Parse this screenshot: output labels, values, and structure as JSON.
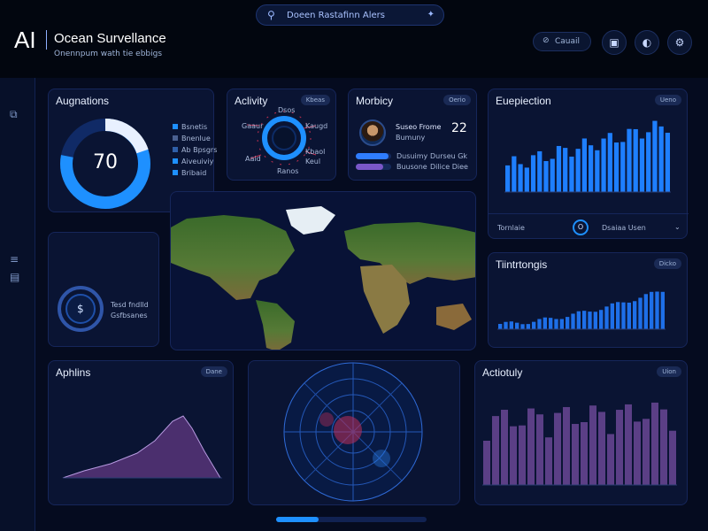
{
  "header": {
    "logo": "AI",
    "title": "Ocean Survellance",
    "subtitle": "Onennpum wath tie ebbigs",
    "search_text": "Doeen Rastafinn Alers",
    "pill_label": "Cauail"
  },
  "panels": {
    "augmentations": {
      "title": "Augnations",
      "value": "70",
      "gauge_fraction": 0.78,
      "legend": [
        "Bsnetis",
        "Bnenlue",
        "Ab Bpsgrs",
        "Aiveuiviy",
        "Bribaid"
      ],
      "legend_colors": [
        "#1e90ff",
        "#4a6090",
        "#2f5fa8",
        "#1e90ff",
        "#1e90ff"
      ]
    },
    "activity_ring": {
      "title": "Aclivity",
      "tag": "Kbeas",
      "labels": [
        "Dsos",
        "Gaaur",
        "Kaugd",
        "Aaid",
        "Kbaol",
        "Keul",
        "Ranos"
      ]
    },
    "monitoring": {
      "title": "Morbicy",
      "tag": "Oerio",
      "person_name": "Suseo Frome",
      "person_role": "Bumuny",
      "count": "22",
      "rows": [
        {
          "left": "Dusuimy",
          "right": "Durseu Gk",
          "fill": 0.92
        },
        {
          "left": "Buusone",
          "right": "Dilice Diee",
          "fill": 0.78
        }
      ]
    },
    "prediction": {
      "title": "Euepiection",
      "tag": "Ueno",
      "footer_left": "Tornlaie",
      "footer_right": "Dsaiaa Usen",
      "footer_icon_text": "O"
    },
    "radar_small": {
      "line1": "Tesd fndlld",
      "line2": "Gsfbsanes"
    },
    "trends": {
      "title": "Tiintrtongis",
      "tag": "Dicko"
    },
    "archives": {
      "title": "Aphlins",
      "tag": "Dane"
    },
    "activity_bars": {
      "title": "Actiotuly",
      "tag": "Uion"
    }
  },
  "colors": {
    "accent": "#1e90ff",
    "purple": "#5b3f86",
    "panel": "#0a1433",
    "background": "#050b1f"
  },
  "icons": {
    "search": "search-icon",
    "sparkle": "sparkle-icon",
    "book": "book-icon",
    "globe": "globe-icon",
    "settings": "settings-icon"
  },
  "scroll": {
    "fraction": 0.28
  }
}
